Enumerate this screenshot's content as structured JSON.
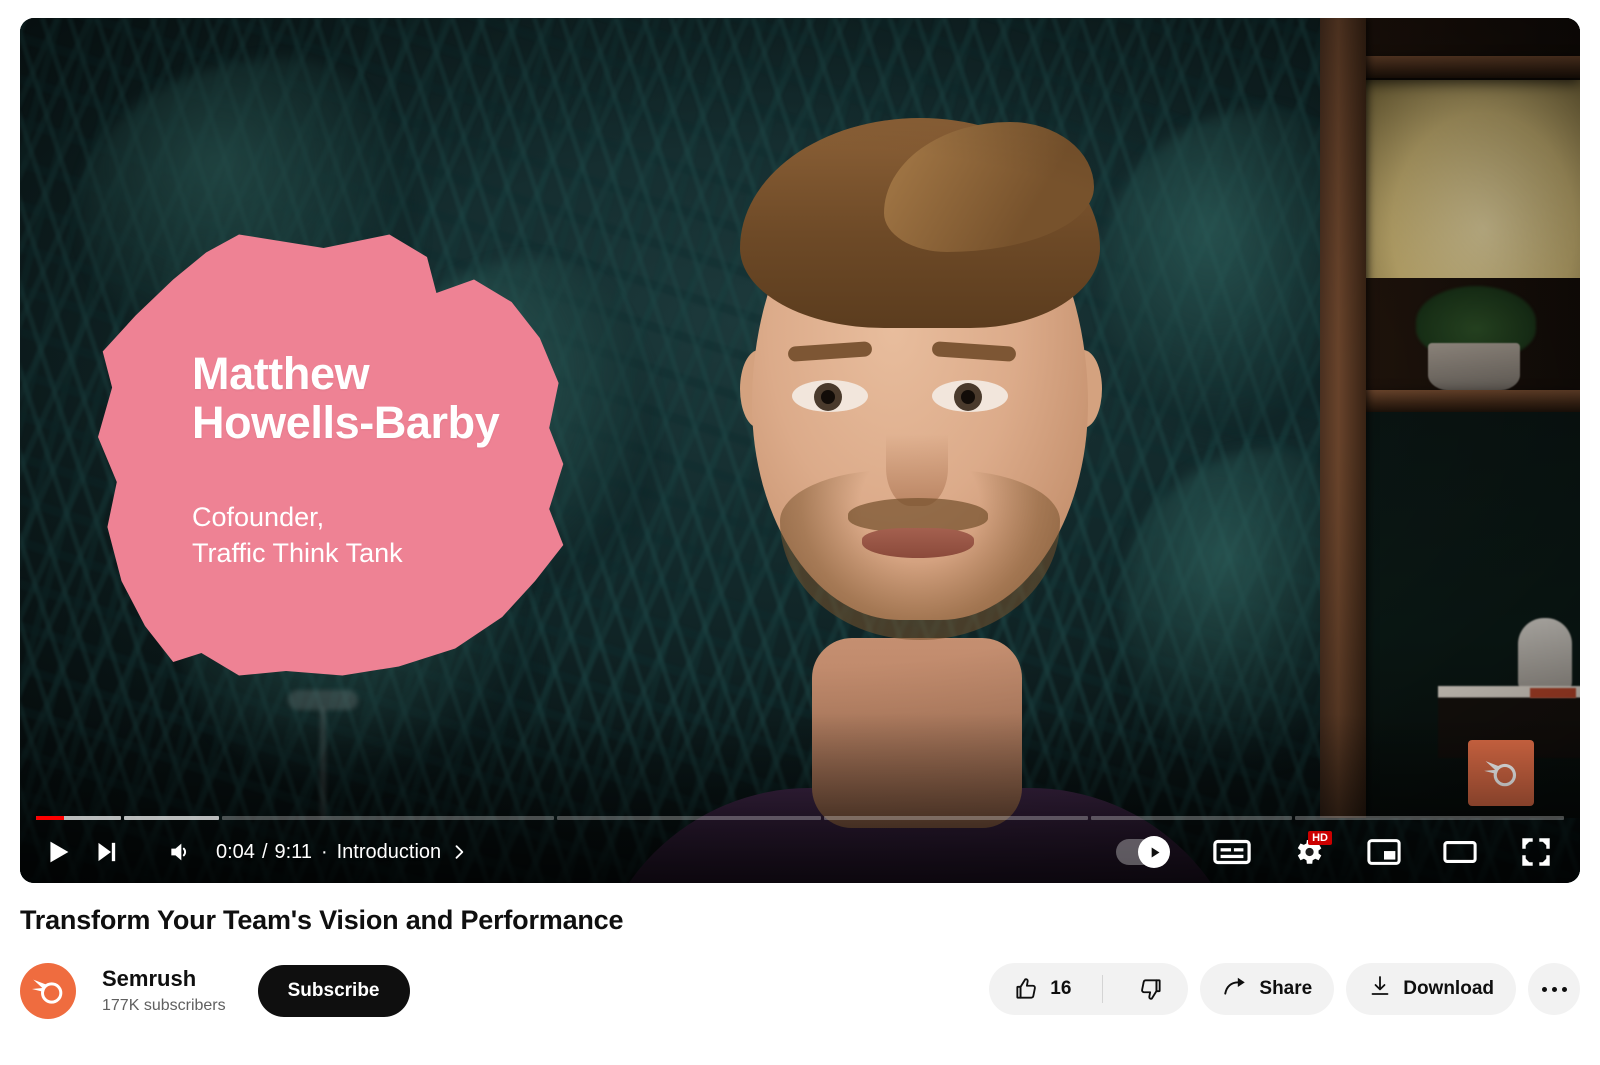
{
  "player": {
    "video": {
      "speaker_name": "Matthew\nHowells-Barby",
      "speaker_name_line1": "Matthew",
      "speaker_name_line2": "Howells-Barby",
      "speaker_role_line1": "Cofounder,",
      "speaker_role_line2": "Traffic Think Tank",
      "watermark": "semrush-watermark-logo",
      "badge_color": "#ee8294"
    },
    "controls": {
      "play_label": "play-icon",
      "next_label": "next-video-icon",
      "volume_label": "volume-icon",
      "current_time": "0:04",
      "time_separator": "/",
      "duration": "9:11",
      "chapter_dot": "·",
      "chapter_name": "Introduction",
      "chapter_arrow": "›",
      "autoplay_label": "autoplay-toggle",
      "autoplay_state": "on",
      "subtitles_label": "subtitles-icon",
      "settings_label": "settings-gear-icon",
      "quality_badge": "HD",
      "miniplayer_label": "miniplayer-icon",
      "theater_label": "theater-mode-icon",
      "fullscreen_label": "fullscreen-icon",
      "progress_color": "#ff0000",
      "buffer_color": "rgba(255,255,255,0.62)",
      "track_color": "rgba(255,255,255,0.28)"
    },
    "progress": {
      "chapters": [
        {
          "name": "Introduction",
          "width_pct": 5.6,
          "buffered_pct": 100,
          "played_pct": 33
        },
        {
          "name": "chapter-2",
          "width_pct": 6.3,
          "buffered_pct": 100,
          "played_pct": 0
        },
        {
          "name": "chapter-3",
          "width_pct": 22.0,
          "buffered_pct": 0,
          "played_pct": 0
        },
        {
          "name": "chapter-4",
          "width_pct": 17.5,
          "buffered_pct": 0,
          "played_pct": 0
        },
        {
          "name": "chapter-5",
          "width_pct": 17.5,
          "buffered_pct": 0,
          "played_pct": 0
        },
        {
          "name": "chapter-6",
          "width_pct": 13.3,
          "buffered_pct": 0,
          "played_pct": 0
        },
        {
          "name": "chapter-7",
          "width_pct": 17.8,
          "buffered_pct": 0,
          "played_pct": 0
        }
      ]
    }
  },
  "below": {
    "title": "Transform Your Team's Vision and Performance",
    "channel": {
      "name": "Semrush",
      "subscribers": "177K subscribers",
      "avatar_label": "semrush-logo",
      "avatar_color": "#ef6c3f"
    },
    "subscribe_label": "Subscribe",
    "actions": {
      "like_count": "16",
      "like_label": "thumbs-up-icon",
      "dislike_label": "thumbs-down-icon",
      "share_label": "Share",
      "download_label": "Download",
      "more_label": "more-actions"
    }
  }
}
